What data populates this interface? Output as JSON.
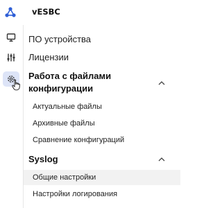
{
  "header": {
    "app_title": "vESBC",
    "logo_icon": "network-nodes-logo-icon",
    "logo_color": "#2f5fd6"
  },
  "rail": {
    "items": [
      {
        "icon": "monitor-icon",
        "active": false
      },
      {
        "icon": "equalizer-icon",
        "active": false
      },
      {
        "icon": "gear-icon",
        "active": true
      }
    ],
    "active_bg": "#dde4f7"
  },
  "menu": {
    "items": [
      {
        "label": "ПО устройства"
      },
      {
        "label": "Лицензии"
      }
    ],
    "sections": [
      {
        "label_line1": "Работа с файлами",
        "label_line2": "конфигурации",
        "expanded": true,
        "children": [
          {
            "label": "Актуальные файлы"
          },
          {
            "label": "Архивные файлы"
          },
          {
            "label": "Сравнение конфигураций"
          }
        ]
      },
      {
        "label": "Syslog",
        "expanded": true,
        "children": [
          {
            "label": "Общие настройки",
            "active": true
          },
          {
            "label": "Настройки логирования"
          }
        ]
      }
    ]
  }
}
